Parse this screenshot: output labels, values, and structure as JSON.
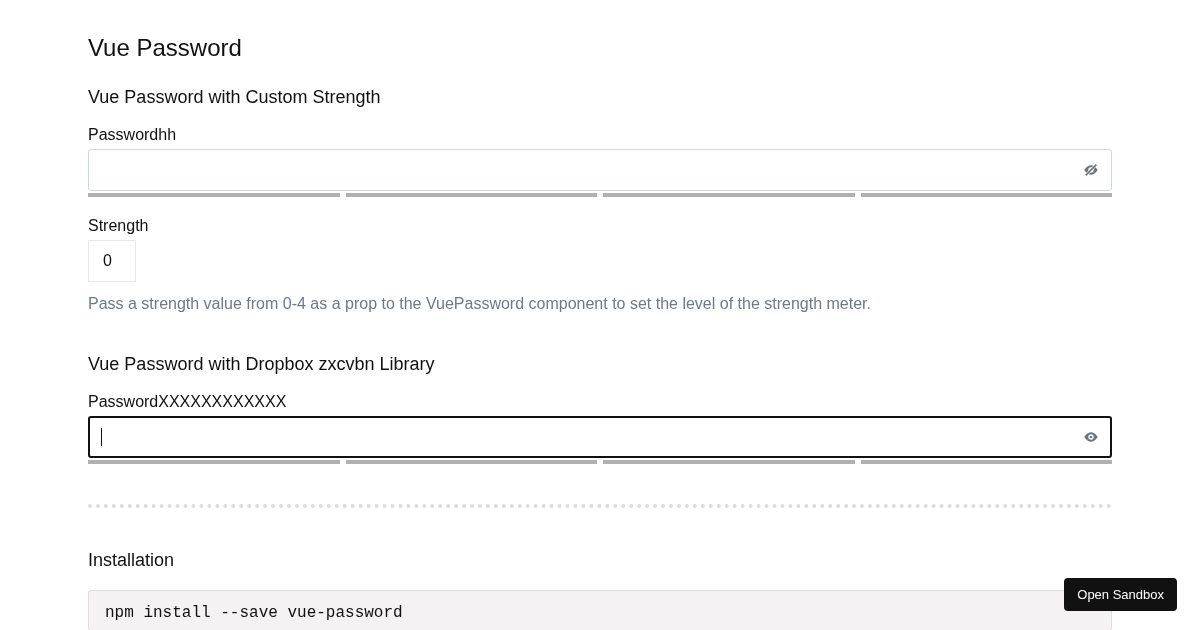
{
  "title": "Vue Password",
  "sections": [
    {
      "heading": "Vue Password with Custom Strength",
      "field": {
        "label": "Passwordhh",
        "focused": false,
        "visible": false,
        "meter": [
          {
            "filled": false
          },
          {
            "filled": false
          },
          {
            "filled": false
          },
          {
            "filled": false
          }
        ]
      },
      "strength": {
        "label": "Strength",
        "value": "0"
      },
      "hint": "Pass a strength value from 0-4 as a prop to the VuePassword component to set the level of the strength meter."
    },
    {
      "heading": "Vue Password with Dropbox zxcvbn Library",
      "field": {
        "label": "PasswordXXXXXXXXXXXX",
        "focused": true,
        "visible": true,
        "meter": [
          {
            "filled": false
          },
          {
            "filled": false
          },
          {
            "filled": false
          },
          {
            "filled": false
          }
        ]
      }
    }
  ],
  "installation": {
    "heading": "Installation",
    "code": "npm install --save vue-password"
  },
  "sandbox_button": "Open Sandbox"
}
